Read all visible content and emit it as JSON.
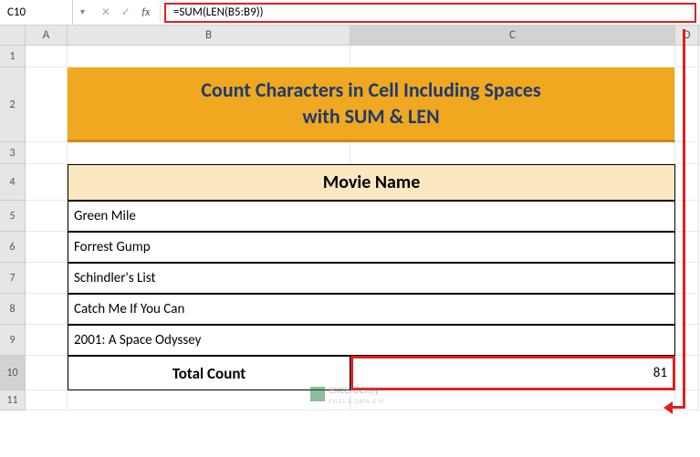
{
  "name_box": "C10",
  "formula": "=SUM(LEN(B5:B9))",
  "columns": {
    "A": "A",
    "B": "B",
    "C": "C",
    "D": "D"
  },
  "rows": [
    "1",
    "2",
    "3",
    "4",
    "5",
    "6",
    "7",
    "8",
    "9",
    "10",
    "11"
  ],
  "title": {
    "line1": "Count Characters in Cell Including Spaces",
    "line2": "with SUM & LEN"
  },
  "header": "Movie Name",
  "movies": [
    "Green Mile",
    "Forrest Gump",
    "Schindler's List",
    "Catch  Me If You Can",
    "2001: A Space Odyssey"
  ],
  "total_label": "Total Count",
  "total_value": "81",
  "watermark": {
    "brand": "exceldemy",
    "sub": "EXCEL & DATA & BI"
  },
  "chart_data": {
    "type": "table",
    "title": "Count Characters in Cell Including Spaces with SUM & LEN",
    "columns": [
      "Movie Name"
    ],
    "rows": [
      [
        "Green Mile"
      ],
      [
        "Forrest Gump"
      ],
      [
        "Schindler's List"
      ],
      [
        "Catch  Me If You Can"
      ],
      [
        "2001: A Space Odyssey"
      ]
    ],
    "summary": {
      "label": "Total Count",
      "value": 81,
      "formula": "=SUM(LEN(B5:B9))"
    }
  }
}
